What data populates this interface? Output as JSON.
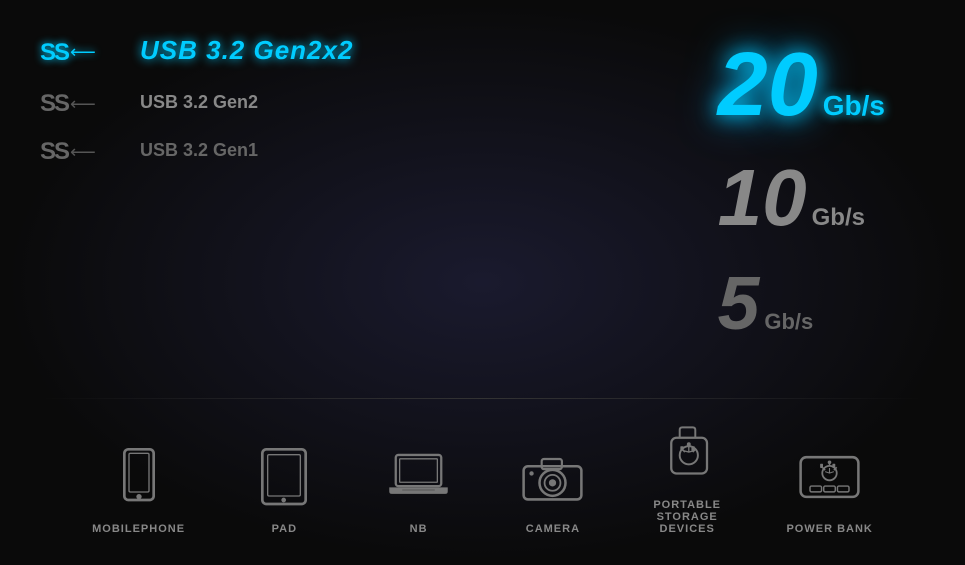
{
  "title": "USB 3.2 Gen2x2",
  "specs": [
    {
      "id": "primary",
      "ss_label": "SS←",
      "label": "USB 3.2 Gen2x2",
      "speed_number": "20",
      "speed_unit": "Gb/s",
      "bar_width": "100%"
    },
    {
      "id": "secondary",
      "ss_label": "SS←",
      "label": "USB 3.2 Gen2",
      "speed_number": "10",
      "speed_unit": "Gb/s",
      "bar_width": "65%"
    },
    {
      "id": "tertiary",
      "ss_label": "SS←",
      "label": "USB 3.2 Gen1",
      "speed_number": "5",
      "speed_unit": "Gb/s",
      "bar_width": "40%"
    }
  ],
  "devices": [
    {
      "id": "mobilephone",
      "label": "MOBILEPHONE"
    },
    {
      "id": "pad",
      "label": "PAD"
    },
    {
      "id": "nb",
      "label": "NB"
    },
    {
      "id": "camera",
      "label": "CAMERA"
    },
    {
      "id": "portable-storage",
      "label": "PORTABLE\nSTORAGE\nDEVICES"
    },
    {
      "id": "power-bank",
      "label": "POWER BANK"
    }
  ]
}
